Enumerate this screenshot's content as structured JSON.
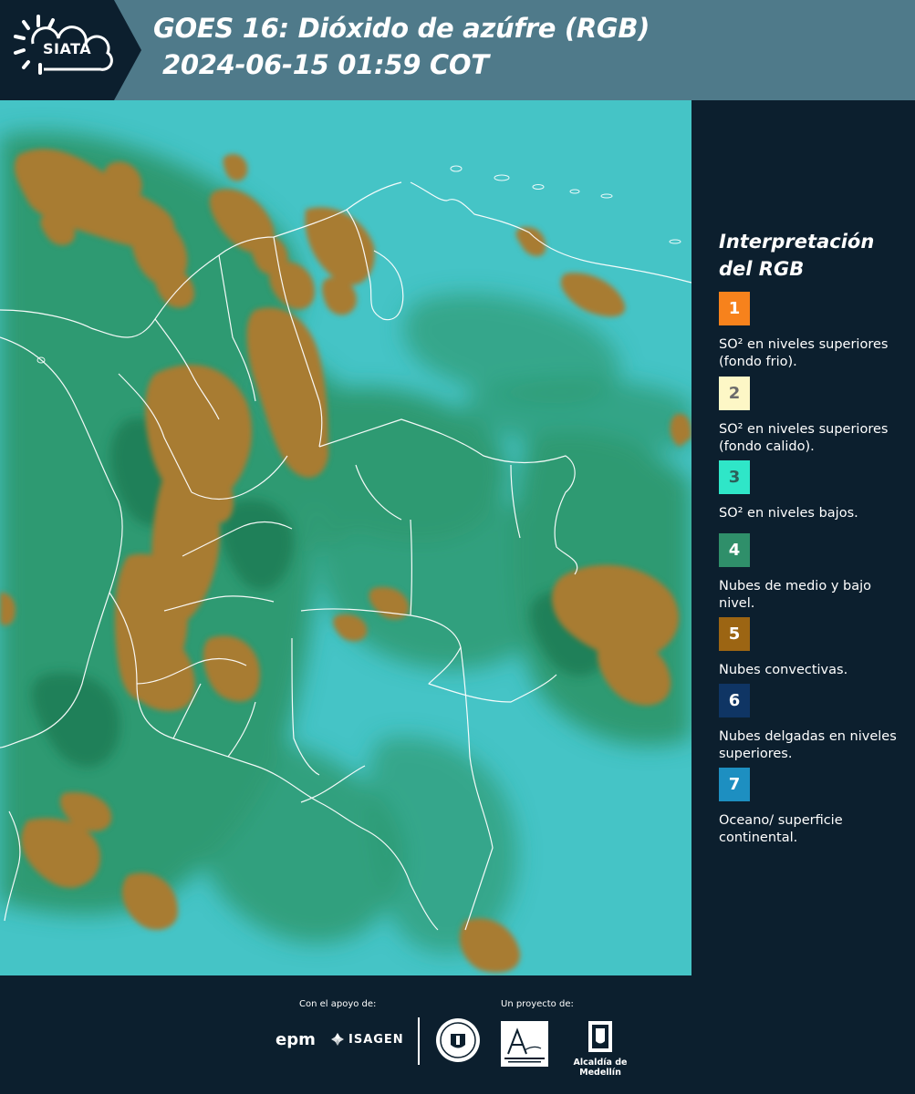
{
  "header": {
    "logo_text": "SIATA",
    "title_line1": "GOES 16: Dióxido de azúfre (RGB)",
    "title_line2": "2024-06-15 01:59 COT"
  },
  "legend": {
    "title_line1": "Interpretación",
    "title_line2": "del RGB",
    "items": [
      {
        "number": "1",
        "color": "#f7821c",
        "label": "SO² en niveles superiores (fondo frio)."
      },
      {
        "number": "2",
        "color": "#fdf7c6",
        "label": "SO² en niveles superiores (fondo calido)."
      },
      {
        "number": "3",
        "color": "#2fe6c8",
        "label": "SO² en niveles bajos."
      },
      {
        "number": "4",
        "color": "#2f8f6a",
        "label": "Nubes de medio y bajo nivel."
      },
      {
        "number": "5",
        "color": "#9c6513",
        "label": "Nubes convectivas."
      },
      {
        "number": "6",
        "color": "#0f3564",
        "label": "Nubes delgadas en niveles superiores."
      },
      {
        "number": "7",
        "color": "#1d8fc1",
        "label": "Oceano/ superficie continental."
      }
    ]
  },
  "footer": {
    "support_label": "Con el apoyo de:",
    "project_label": "Un proyecto de:",
    "sponsor_1": "epm",
    "sponsor_2": "ISAGEN",
    "partner_1": "Área Metropolitana Valle de Aburrá",
    "partner_2": "Alcaldía de Medellín"
  },
  "colors": {
    "header_bg": "#4f7a8a",
    "panel_bg": "#0c1f2e",
    "map_ocean": "#3fc1c5",
    "map_land": "#2e9a72",
    "map_cloud": "#a77a2e",
    "border_line": "#ffffff"
  }
}
